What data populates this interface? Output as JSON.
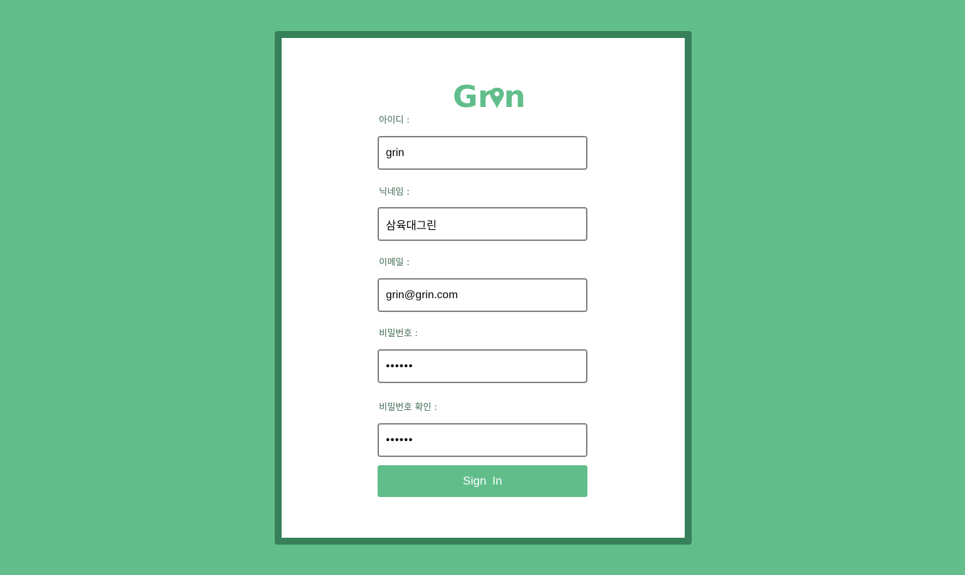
{
  "colors": {
    "background": "#61be8b",
    "card_border": "#36805a",
    "brand": "#61be8b",
    "label_text": "#3f6b52"
  },
  "logo": {
    "text": "Grin",
    "icon": "map-pin-icon"
  },
  "form": {
    "id": {
      "label": "아이디 :",
      "value": "grin"
    },
    "nickname": {
      "label": "닉네임 :",
      "value": "삼육대그린"
    },
    "email": {
      "label": "이메일 :",
      "value": "grin@grin.com"
    },
    "password": {
      "label": "비밀번호 :",
      "value": "••••••"
    },
    "password_confirm": {
      "label": "비밀번호 확인 :",
      "value": "••••••"
    },
    "submit_label": "Sign  In"
  }
}
